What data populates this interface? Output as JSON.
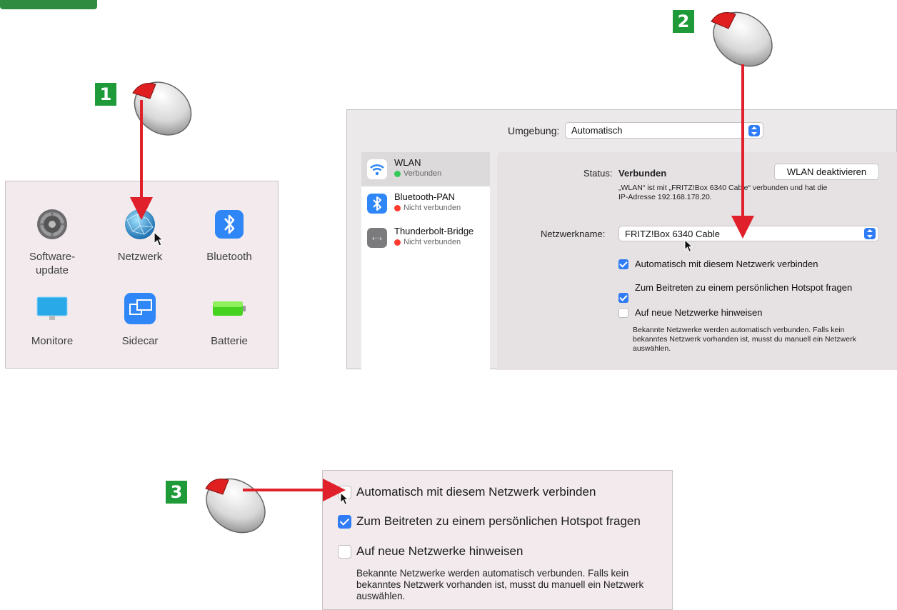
{
  "steps": {
    "one": "1",
    "two": "2",
    "three": "3"
  },
  "prefs": {
    "items": [
      {
        "label": "Software-\nupdate",
        "icon": "gear-icon"
      },
      {
        "label": "Netzwerk",
        "icon": "globe-icon"
      },
      {
        "label": "Bluetooth",
        "icon": "bluetooth-icon"
      },
      {
        "label": "Monitore",
        "icon": "monitor-icon"
      },
      {
        "label": "Sidecar",
        "icon": "sidecar-icon"
      },
      {
        "label": "Batterie",
        "icon": "battery-icon"
      }
    ]
  },
  "network": {
    "env_label": "Umgebung:",
    "env_value": "Automatisch",
    "services": [
      {
        "name": "WLAN",
        "status": "Verbunden",
        "status_color": "#34c759",
        "icon": "wifi-icon"
      },
      {
        "name": "Bluetooth-PAN",
        "status": "Nicht verbunden",
        "status_color": "#ff3b30",
        "icon": "bluetooth-icon"
      },
      {
        "name": "Thunderbolt-Bridge",
        "status": "Nicht verbunden",
        "status_color": "#ff3b30",
        "icon": "thunderbolt-icon"
      }
    ],
    "status_label": "Status:",
    "status_value": "Verbunden",
    "wlan_button": "WLAN deaktivieren",
    "status_desc_1": "„WLAN“ ist mit „FRITZ!Box 6340 Cable“ verbunden und hat die",
    "status_desc_2": "IP-Adresse 192.168.178.20.",
    "netname_label": "Netzwerkname:",
    "netname_value": "FRITZ!Box 6340 Cable",
    "checkboxes": [
      {
        "label": "Automatisch mit diesem Netzwerk verbinden",
        "checked": true
      },
      {
        "label": "Zum Beitreten zu einem persönlichen Hotspot fragen",
        "checked": true
      },
      {
        "label": "Auf neue Netzwerke hinweisen",
        "checked": false
      }
    ],
    "hint_1": "Bekannte Netzwerke werden automatisch verbunden. Falls kein",
    "hint_2": "bekanntes Netzwerk vorhanden ist, musst du manuell ein Netzwerk",
    "hint_3": "auswählen."
  },
  "zoom": {
    "checkboxes": [
      {
        "label": "Automatisch mit diesem Netzwerk verbinden",
        "checked": false
      },
      {
        "label": "Zum Beitreten zu einem persönlichen Hotspot fragen",
        "checked": true
      },
      {
        "label": "Auf neue Netzwerke hinweisen",
        "checked": false
      }
    ],
    "hint_1": "Bekannte Netzwerke werden automatisch verbunden. Falls kein",
    "hint_2": "bekanntes Netzwerk vorhanden ist, musst du manuell ein Netzwerk",
    "hint_3": "auswählen."
  },
  "colors": {
    "accent": "#2f7cf6",
    "badge": "#1f9a38",
    "arrow": "#e0202a"
  }
}
